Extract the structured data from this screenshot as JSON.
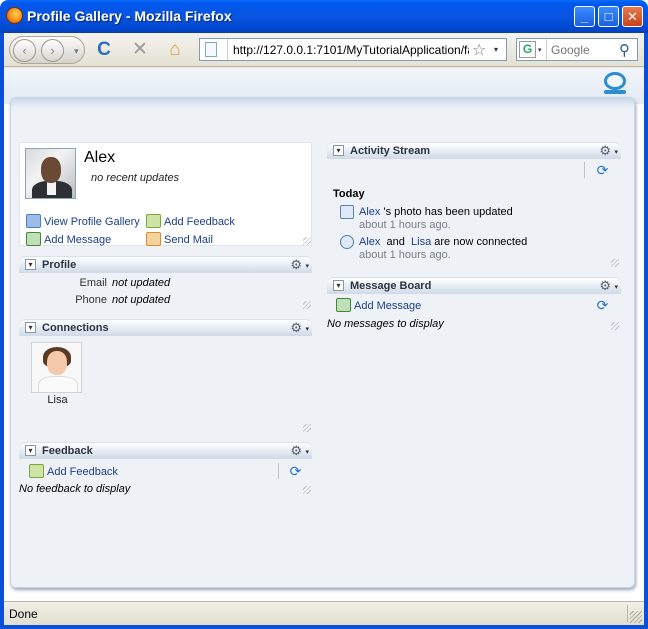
{
  "window": {
    "title": "Profile Gallery - Mozilla Firefox",
    "minimize": "_",
    "maximize": "□",
    "close": "✕"
  },
  "toolbar": {
    "back": "‹",
    "forward": "›",
    "dropdown": "▾",
    "reload": "C",
    "stop": "✕",
    "home": "⌂",
    "url": "http://127.0.0.1:7101/MyTutorialApplication/fac",
    "bookmark_star": "☆",
    "search_engine": "G",
    "search_placeholder": "Google",
    "search_icon": "⚲"
  },
  "profile": {
    "name": "Alex",
    "status": "no recent updates",
    "actions": [
      {
        "label": "View Profile Gallery",
        "icon": "people-icon",
        "color": "#4a7fc8"
      },
      {
        "label": "Add Feedback",
        "icon": "add-feedback-icon",
        "color": "#79a83a"
      },
      {
        "label": "Add Message",
        "icon": "add-message-icon",
        "color": "#3f8a3a"
      },
      {
        "label": "Send Mail",
        "icon": "mail-icon",
        "color": "#d88a2c"
      }
    ]
  },
  "profile_portlet": {
    "title": "Profile",
    "fields": [
      {
        "label": "Email",
        "value": "not updated"
      },
      {
        "label": "Phone",
        "value": "not updated"
      }
    ]
  },
  "connections_portlet": {
    "title": "Connections",
    "people": [
      {
        "name": "Lisa"
      }
    ]
  },
  "feedback_portlet": {
    "title": "Feedback",
    "add_label": "Add Feedback",
    "empty": "No feedback to display"
  },
  "activity_portlet": {
    "title": "Activity Stream",
    "group": "Today",
    "items": [
      {
        "actor": "Alex",
        "text": "'s photo has been updated",
        "time": "about 1 hours ago."
      },
      {
        "actor": "Alex",
        "and": "and",
        "actor2": "Lisa",
        "text": "are now connected",
        "time": "about 1 hours ago."
      }
    ]
  },
  "message_portlet": {
    "title": "Message Board",
    "add_label": "Add Message",
    "empty": "No messages to display"
  },
  "portlet_controls": {
    "toggle": "▾",
    "gear": "⚙",
    "gear_drop": "▾",
    "refresh": "⟳"
  },
  "statusbar": {
    "text": "Done"
  }
}
